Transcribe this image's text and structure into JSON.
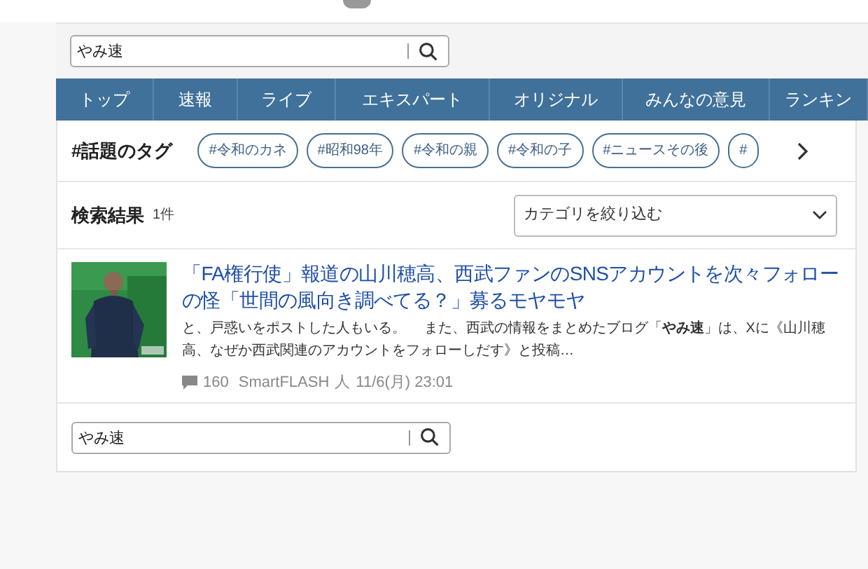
{
  "search_top": {
    "value": "やみ速"
  },
  "nav": [
    {
      "label": "トップ",
      "selected": false
    },
    {
      "label": "速報",
      "selected": false
    },
    {
      "label": "ライブ",
      "selected": false
    },
    {
      "label": "エキスパート",
      "selected": false
    },
    {
      "label": "オリジナル",
      "selected": false
    },
    {
      "label": "みんなの意見",
      "selected": false
    },
    {
      "label": "ランキン",
      "selected": false
    }
  ],
  "tags": {
    "title": "#話題のタグ",
    "items": [
      "#令和のカネ",
      "#昭和98年",
      "#令和の親",
      "#令和の子",
      "#ニュースその後",
      "#"
    ]
  },
  "results": {
    "title": "検索結果",
    "count": "1件",
    "filter": {
      "placeholder": "カテゴリを絞り込む"
    }
  },
  "articles": [
    {
      "title": "「FA権行使」報道の山川穂高、西武ファンのSNSアカウントを次々フォローの怪「世間の風向き調べてる？」募るモヤモヤ",
      "snippet": "と、戸惑いをポストした人もいる。　 また、西武の情報をまとめたブログ「**やみ速**」は、Xに《山川穂高、なぜか西武関連のアカウントをフォローしだす》と投稿…",
      "comments": "160",
      "source": "SmartFLASH",
      "mark": "人",
      "date": "11/6(月) 23:01"
    }
  ],
  "search_bottom": {
    "value": "やみ速"
  }
}
